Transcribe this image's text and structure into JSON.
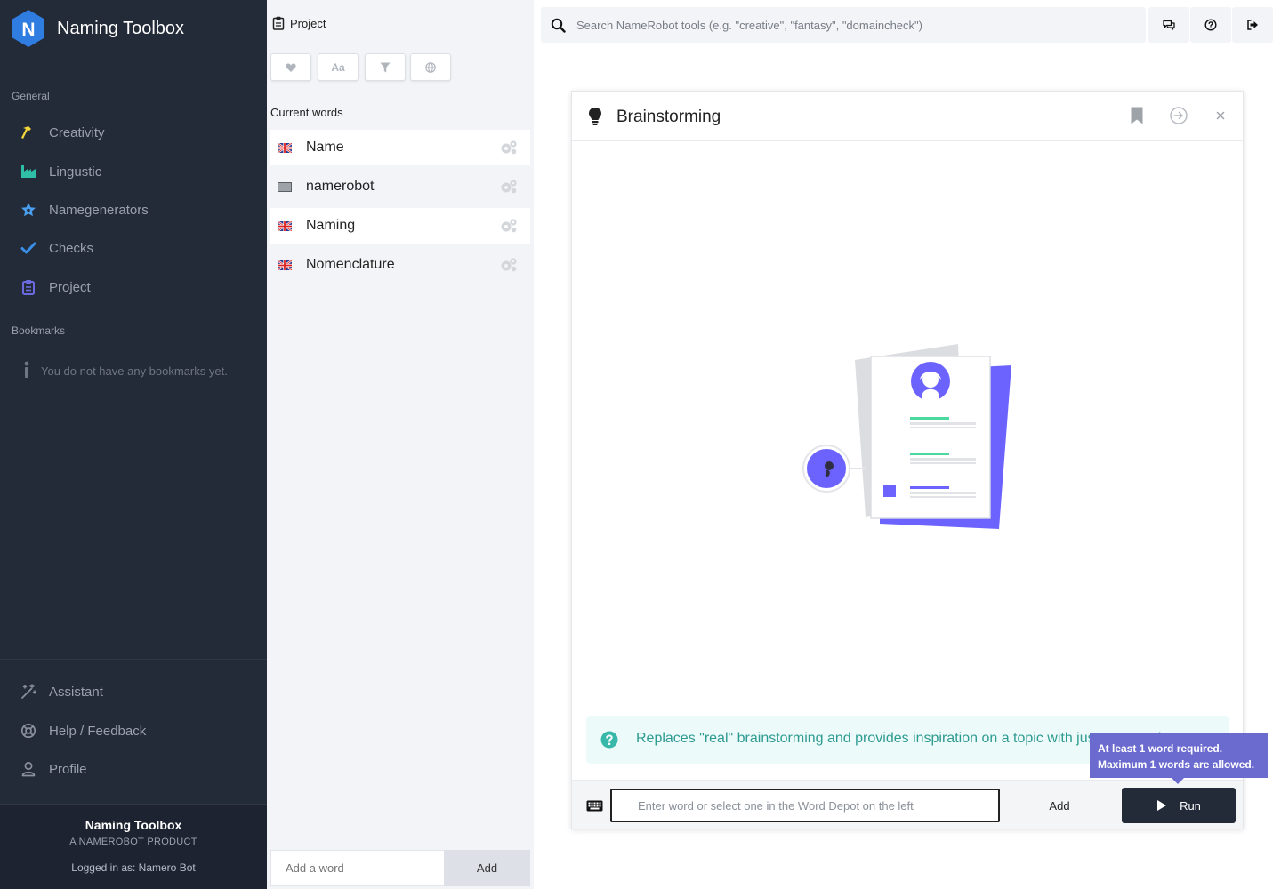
{
  "sidebar": {
    "brand": {
      "letter": "N",
      "name": "Naming Toolbox",
      "color": "#2f7de1"
    },
    "general_label": "General",
    "nav": [
      {
        "label": "Creativity",
        "icon": "hammer-icon",
        "color": "#f5d63b"
      },
      {
        "label": "Lingustic",
        "icon": "factory-icon",
        "color": "#2fbfa7"
      },
      {
        "label": "Namegenerators",
        "icon": "star-icon",
        "color": "#4a9ff0"
      },
      {
        "label": "Checks",
        "icon": "check-icon",
        "color": "#3a8ee6"
      },
      {
        "label": "Project",
        "icon": "clipboard-icon",
        "color": "#6b6bdf"
      }
    ],
    "bookmarks_label": "Bookmarks",
    "bookmarks_empty": "You do not have any bookmarks yet.",
    "bottom_nav": [
      {
        "label": "Assistant",
        "icon": "magic-wand-icon"
      },
      {
        "label": "Help / Feedback",
        "icon": "lifebuoy-icon"
      },
      {
        "label": "Profile",
        "icon": "user-icon"
      }
    ],
    "footer": {
      "title": "Naming Toolbox",
      "subtitle": "A NAMEROBOT PRODUCT",
      "login": "Logged in as: Namero Bot"
    }
  },
  "depot": {
    "title": "Project",
    "filters": [
      {
        "icon": "heart-icon",
        "text": ""
      },
      {
        "icon": "font-case-icon",
        "text": "Aa"
      },
      {
        "icon": "filter-icon",
        "text": ""
      },
      {
        "icon": "globe-icon",
        "text": ""
      }
    ],
    "current_words_label": "Current words",
    "words": [
      {
        "text": "Name",
        "flag": "uk-flag-icon",
        "selected": true
      },
      {
        "text": "namerobot",
        "flag": "neutral-flag-icon",
        "selected": false
      },
      {
        "text": "Naming",
        "flag": "uk-flag-icon",
        "selected": true
      },
      {
        "text": "Nomenclature",
        "flag": "uk-flag-icon",
        "selected": false
      }
    ],
    "add_placeholder": "Add a word",
    "add_button": "Add"
  },
  "topbar": {
    "search_placeholder": "Search NameRobot tools (e.g. \"creative\", \"fantasy\", \"domaincheck\")",
    "buttons": [
      "chat-icon",
      "help-circle-icon",
      "logout-icon"
    ]
  },
  "panel": {
    "title": "Brainstorming",
    "info_text": "Replaces \"real\" brainstorming and provides inspiration on a topic with just one word.",
    "input_placeholder": "Enter word or select one in the Word Depot on the left",
    "add_button": "Add",
    "run_button": "Run",
    "tooltip": {
      "line1": "At least 1 word required.",
      "line2": "Maximum 1 words are allowed."
    },
    "accent_color": "#6c63ff"
  }
}
